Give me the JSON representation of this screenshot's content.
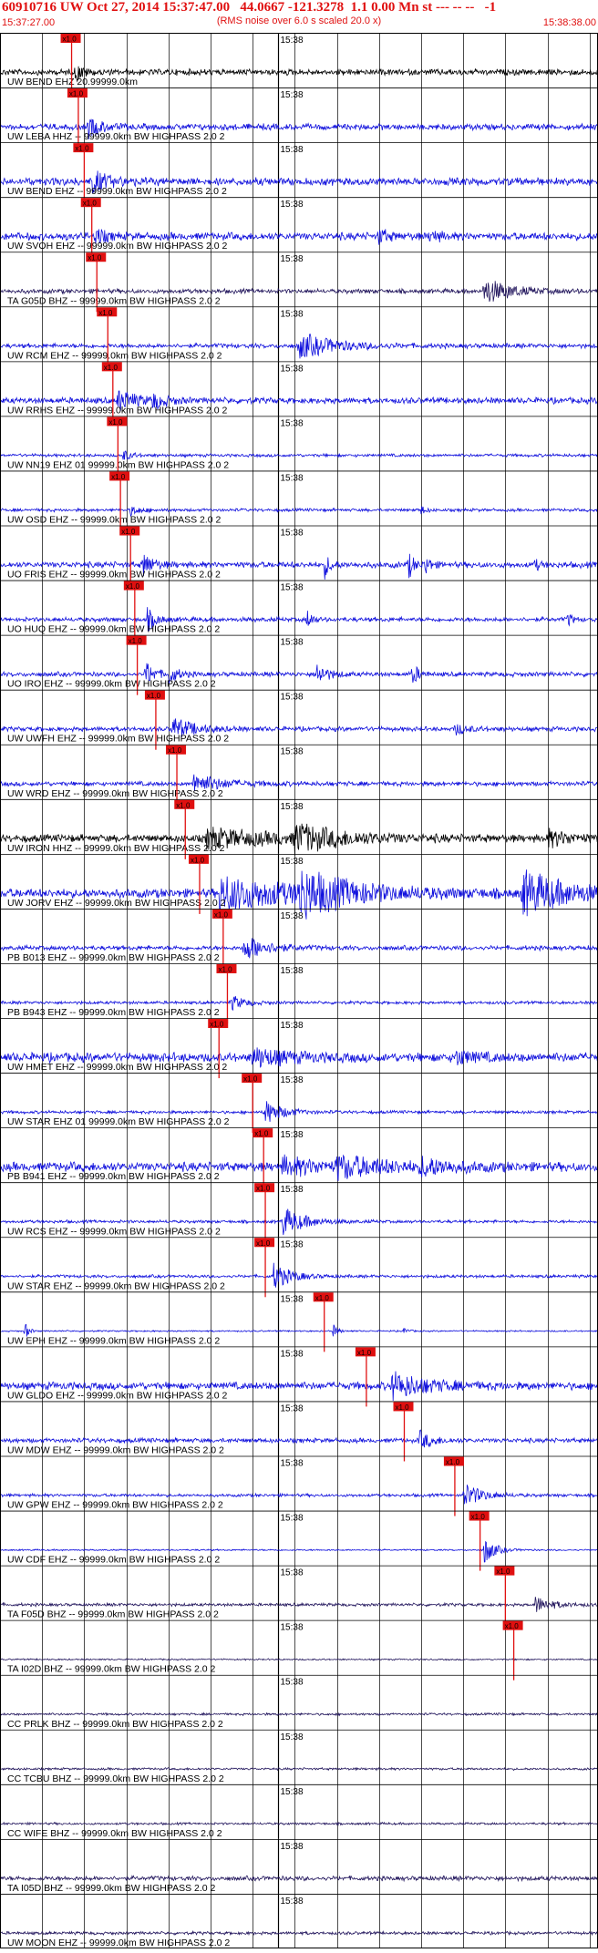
{
  "header": {
    "title": "60910716 UW Oct 27, 2014 15:37:47.00   44.0667 -121.3278  1.1 0.00 Mn st --- -- --   -1",
    "subtitle": "(RMS noise over 6.0 s scaled 20.0 x)",
    "start_time": "15:37:27.00",
    "end_time": "15:38:38.00"
  },
  "colors": {
    "header": "#e01010",
    "pick": "#e01010",
    "grid": "#000000",
    "blue": "#1010dd",
    "black": "#000000",
    "purple": "#24185e"
  },
  "chart_data": {
    "type": "line",
    "title": "60910716 UW Oct 27, 2014 15:37:47.00   44.0667 -121.3278  1.1 0.00 Mn st --- -- --   -1",
    "x_range_seconds": [
      0,
      71
    ],
    "minute_tick_label": "15:38",
    "minute_tick_second": 33,
    "pick_label": "x1.0",
    "grid": true,
    "traces": [
      {
        "label": "UW BEND EHZ 20.99999.0km",
        "color": "black",
        "pick_s": 8.5,
        "amp": 4,
        "events": [
          {
            "t": 8.9,
            "a": 10,
            "d": 1
          }
        ]
      },
      {
        "label": "UW LEBA HHZ -- 99999.0km BW  HIGHPASS  2.0  2",
        "color": "blue",
        "pick_s": 9.3,
        "amp": 4,
        "events": [
          {
            "t": 10.5,
            "a": 11,
            "d": 1.5
          }
        ]
      },
      {
        "label": "UW BEND EHZ -- 99999.0km BW  HIGHPASS  2.0  2",
        "color": "blue",
        "pick_s": 10.0,
        "amp": 5,
        "events": [
          {
            "t": 10.8,
            "a": 13,
            "d": 1.8
          }
        ]
      },
      {
        "label": "UW SVOH EHZ -- 99999.0km BW  HIGHPASS  2.0  2",
        "color": "blue",
        "pick_s": 10.9,
        "amp": 5,
        "events": [
          {
            "t": 11.3,
            "a": 10,
            "d": 1
          },
          {
            "t": 45,
            "a": 8,
            "d": 1
          },
          {
            "t": 51,
            "a": 7,
            "d": 1
          }
        ]
      },
      {
        "label": "TA G05D BHZ -- 99999.0km BW  HIGHPASS  2.0  2",
        "color": "purple",
        "pick_s": 11.5,
        "amp": 3,
        "events": [
          {
            "t": 57.5,
            "a": 14,
            "d": 3
          }
        ]
      },
      {
        "label": "UW RCM EHZ -- 99999.0km BW  HIGHPASS  2.0  2",
        "color": "blue",
        "pick_s": 12.8,
        "amp": 3,
        "events": [
          {
            "t": 35.5,
            "a": 14,
            "d": 4
          }
        ]
      },
      {
        "label": "UW RRHS EHZ -- 99999.0km BW  HIGHPASS  2.0  2",
        "color": "blue",
        "pick_s": 13.4,
        "amp": 4,
        "events": [
          {
            "t": 14.0,
            "a": 12,
            "d": 2
          },
          {
            "t": 18.0,
            "a": 8,
            "d": 1.5
          }
        ]
      },
      {
        "label": "UW NN19 EHZ 01 99999.0km BW  HIGHPASS  2.0  2",
        "color": "blue",
        "pick_s": 14.0,
        "amp": 2,
        "events": [
          {
            "t": 14.6,
            "a": 6,
            "d": 1
          }
        ]
      },
      {
        "label": "UW OSD EHZ -- 99999.0km BW  HIGHPASS  2.0  2",
        "color": "blue",
        "pick_s": 14.3,
        "amp": 2,
        "events": [
          {
            "t": 15.5,
            "a": 5,
            "d": 1.2
          },
          {
            "t": 50,
            "a": 5,
            "d": 0.5
          }
        ]
      },
      {
        "label": "UO FRIS EHZ -- 99999.0km BW  HIGHPASS  2.0  2",
        "color": "blue",
        "pick_s": 15.5,
        "amp": 4,
        "events": [
          {
            "t": 17.0,
            "a": 14,
            "d": 1
          },
          {
            "t": 38.5,
            "a": 14,
            "d": 0.6
          },
          {
            "t": 48.5,
            "a": 14,
            "d": 0.6
          },
          {
            "t": 50.5,
            "a": 12,
            "d": 0.5
          },
          {
            "t": 63.5,
            "a": 8,
            "d": 0.4
          }
        ]
      },
      {
        "label": "UO HUQ EHZ -- 99999.0km BW  HIGHPASS  2.0  2",
        "color": "blue",
        "pick_s": 16.0,
        "amp": 3,
        "events": [
          {
            "t": 17.5,
            "a": 12,
            "d": 1
          },
          {
            "t": 36.5,
            "a": 12,
            "d": 0.5
          },
          {
            "t": 67.5,
            "a": 8,
            "d": 0.4
          }
        ]
      },
      {
        "label": "UO IRO EHZ -- 99999.0km BW  HIGHPASS  2.0  2",
        "color": "blue",
        "pick_s": 16.3,
        "amp": 3,
        "events": [
          {
            "t": 17.3,
            "a": 14,
            "d": 1
          },
          {
            "t": 20.0,
            "a": 10,
            "d": 1
          },
          {
            "t": 37.5,
            "a": 13,
            "d": 1.2
          },
          {
            "t": 49.0,
            "a": 13,
            "d": 0.6
          }
        ]
      },
      {
        "label": "UW UWFH EHZ -- 99999.0km BW  HIGHPASS  2.0  2",
        "color": "blue",
        "pick_s": 18.5,
        "amp": 3,
        "events": [
          {
            "t": 20.5,
            "a": 12,
            "d": 2.5
          },
          {
            "t": 54.0,
            "a": 6,
            "d": 1.5
          }
        ]
      },
      {
        "label": "UW WRD EHZ -- 99999.0km BW  HIGHPASS  2.0  2",
        "color": "blue",
        "pick_s": 21.0,
        "amp": 3,
        "events": [
          {
            "t": 23.0,
            "a": 11,
            "d": 3
          }
        ]
      },
      {
        "label": "UW IRON HHZ -- 99999.0km BW  HIGHPASS  2.0  2",
        "color": "black",
        "pick_s": 22.0,
        "amp": 5,
        "events": [
          {
            "t": 24.5,
            "a": 10,
            "d": 8
          },
          {
            "t": 35.0,
            "a": 14,
            "d": 5
          },
          {
            "t": 65.0,
            "a": 8,
            "d": 3
          }
        ]
      },
      {
        "label": "UW JORV EHZ -- 99999.0km BW  HIGHPASS  2.0  2",
        "color": "blue",
        "pick_s": 23.7,
        "amp": 6,
        "events": [
          {
            "t": 26.0,
            "a": 18,
            "d": 10
          },
          {
            "t": 35.5,
            "a": 22,
            "d": 5
          },
          {
            "t": 62.0,
            "a": 24,
            "d": 5
          }
        ]
      },
      {
        "label": "PB B013 EHZ -- 99999.0km BW  HIGHPASS  2.0  2",
        "color": "blue",
        "pick_s": 26.5,
        "amp": 3,
        "events": [
          {
            "t": 29.0,
            "a": 14,
            "d": 2.5
          }
        ]
      },
      {
        "label": "PB B943 EHZ -- 99999.0km BW  HIGHPASS  2.0  2",
        "color": "blue",
        "pick_s": 27.0,
        "amp": 2,
        "events": [
          {
            "t": 27.5,
            "a": 8,
            "d": 1.5
          }
        ]
      },
      {
        "label": "UW HMET EHZ -- 99999.0km BW  HIGHPASS  2.0  2",
        "color": "blue",
        "pick_s": 26.0,
        "amp": 6,
        "events": [
          {
            "t": 30.0,
            "a": 10,
            "d": 4
          },
          {
            "t": 54.0,
            "a": 8,
            "d": 2
          }
        ]
      },
      {
        "label": "UW STAR EHZ 01 99999.0km BW  HIGHPASS  2.0  2",
        "color": "blue",
        "pick_s": 30.0,
        "amp": 2,
        "events": [
          {
            "t": 31.5,
            "a": 13,
            "d": 2
          }
        ]
      },
      {
        "label": "PB B941 EHZ -- 99999.0km BW  HIGHPASS  2.0  2",
        "color": "blue",
        "pick_s": 31.3,
        "amp": 6,
        "events": [
          {
            "t": 33.5,
            "a": 9,
            "d": 5
          },
          {
            "t": 40.0,
            "a": 10,
            "d": 6
          },
          {
            "t": 50.0,
            "a": 8,
            "d": 3
          }
        ]
      },
      {
        "label": "UW RCS EHZ -- 99999.0km BW  HIGHPASS  2.0  2",
        "color": "blue",
        "pick_s": 31.5,
        "amp": 2,
        "events": [
          {
            "t": 33.5,
            "a": 16,
            "d": 2.5
          }
        ]
      },
      {
        "label": "UW STAR EHZ -- 99999.0km BW  HIGHPASS  2.0  2",
        "color": "blue",
        "pick_s": 31.5,
        "amp": 2,
        "events": [
          {
            "t": 32.5,
            "a": 14,
            "d": 2
          }
        ]
      },
      {
        "label": "UW EPH EHZ -- 99999.0km BW  HIGHPASS  2.0  2",
        "color": "blue",
        "pick_s": 38.5,
        "amp": 1,
        "events": [
          {
            "t": 3.0,
            "a": 10,
            "d": 0.4
          },
          {
            "t": 39.5,
            "a": 8,
            "d": 0.5
          },
          {
            "t": 48.0,
            "a": 5,
            "d": 0.4
          }
        ]
      },
      {
        "label": "UW GLDO EHZ -- 99999.0km BW  HIGHPASS  2.0  2",
        "color": "blue",
        "pick_s": 43.5,
        "amp": 5,
        "events": [
          {
            "t": 46.5,
            "a": 14,
            "d": 4
          }
        ]
      },
      {
        "label": "UW MDW EHZ -- 99999.0km BW  HIGHPASS  2.0  2",
        "color": "blue",
        "pick_s": 48.0,
        "amp": 3,
        "events": [
          {
            "t": 49.8,
            "a": 10,
            "d": 1.5
          }
        ]
      },
      {
        "label": "UW GPW EHZ -- 99999.0km BW  HIGHPASS  2.0  2",
        "color": "blue",
        "pick_s": 54.0,
        "amp": 2,
        "events": [
          {
            "t": 55.0,
            "a": 14,
            "d": 2
          }
        ]
      },
      {
        "label": "UW CDF EHZ -- 99999.0km BW  HIGHPASS  2.0  2",
        "color": "blue",
        "pick_s": 57.0,
        "amp": 1,
        "events": [
          {
            "t": 57.5,
            "a": 16,
            "d": 1.2
          }
        ]
      },
      {
        "label": "TA F05D BHZ -- 99999.0km BW  HIGHPASS  2.0  2",
        "color": "purple",
        "pick_s": 60.0,
        "amp": 2,
        "events": [
          {
            "t": 63.5,
            "a": 9,
            "d": 2
          }
        ]
      },
      {
        "label": "TA I02D BHZ -- 99999.0km BW  HIGHPASS  2.0  2",
        "color": "purple",
        "pick_s": 61.0,
        "amp": 1,
        "events": []
      },
      {
        "label": "CC PRLK BHZ -- 99999.0km BW  HIGHPASS  2.0  2",
        "color": "purple",
        "pick_s": null,
        "amp": 1.5,
        "events": []
      },
      {
        "label": "CC TCBU BHZ -- 99999.0km BW  HIGHPASS  2.0  2",
        "color": "purple",
        "pick_s": null,
        "amp": 1.5,
        "events": []
      },
      {
        "label": "CC WIFE BHZ -- 99999.0km BW  HIGHPASS  2.0  2",
        "color": "purple",
        "pick_s": null,
        "amp": 1.5,
        "events": []
      },
      {
        "label": "TA I05D BHZ -- 99999.0km BW  HIGHPASS  2.0  2",
        "color": "purple",
        "pick_s": null,
        "amp": 3,
        "events": []
      },
      {
        "label": "UW MOON EHZ -- 99999.0km BW  HIGHPASS  2.0  2",
        "color": "purple",
        "pick_s": null,
        "amp": 2,
        "events": []
      }
    ]
  }
}
